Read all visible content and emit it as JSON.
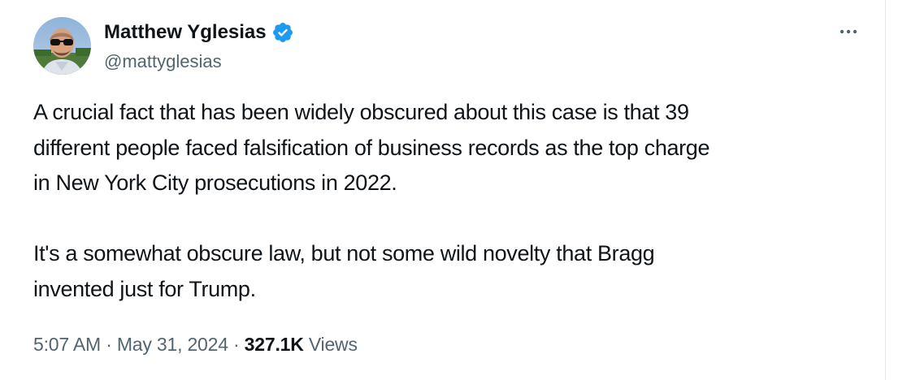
{
  "author": {
    "display_name": "Matthew Yglesias",
    "handle": "@mattyglesias",
    "verified": true,
    "avatar_icon": "profile-photo"
  },
  "more_icon": "ellipsis-icon",
  "tweet": {
    "paragraphs": [
      "A crucial fact that has been widely obscured about this case is that 39\ndifferent people faced falsification of business records as the top charge\nin New York City prosecutions in 2022.",
      "It's a somewhat obscure law, but not some wild novelty that Bragg\ninvented just for Trump."
    ]
  },
  "meta": {
    "time": "5:07 AM",
    "separator": " · ",
    "date": "May 31, 2024",
    "views_count": "327.1K",
    "views_label": " Views"
  },
  "colors": {
    "text_primary": "#0f1419",
    "text_secondary": "#536471",
    "verified_blue": "#1d9bf0"
  }
}
